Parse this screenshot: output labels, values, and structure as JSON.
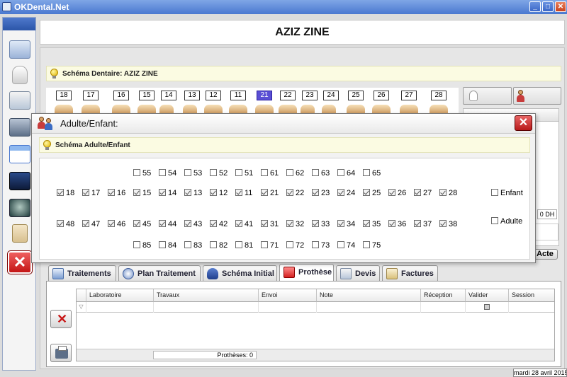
{
  "window": {
    "title": "OKDental.Net",
    "minimize": "_",
    "maximize": "□",
    "close": "✕"
  },
  "colors": {
    "titlebar": "#4a78d0",
    "selected_tooth": "#5a4fd4",
    "info_bar": "#fbfbe2"
  },
  "sidebar": {
    "items": [
      {
        "name": "patient-card-icon"
      },
      {
        "name": "tooth-icon"
      },
      {
        "name": "documents-icon"
      },
      {
        "name": "cash-register-icon"
      },
      {
        "name": "calendar-window-icon"
      },
      {
        "name": "camera-icon"
      },
      {
        "name": "xray-icon"
      },
      {
        "name": "notes-icon"
      }
    ],
    "exit_label": "✕"
  },
  "patient": {
    "name": "AZIZ ZINE"
  },
  "schema": {
    "title": "Schéma Dentaire: AZIZ ZINE",
    "upper_teeth": [
      "18",
      "17",
      "16",
      "15",
      "14",
      "13",
      "12",
      "11",
      "21",
      "22",
      "23",
      "24",
      "25",
      "26",
      "27",
      "28"
    ],
    "selected_tooth": "21"
  },
  "right_panel": {
    "amount": "0 DH",
    "acte_button": "Acte"
  },
  "dialog": {
    "title": "Adulte/Enfant:",
    "close_label": "✕",
    "info": "Schéma Adulte/Enfant",
    "child_upper": [
      "55",
      "54",
      "53",
      "52",
      "51",
      "61",
      "62",
      "63",
      "64",
      "65"
    ],
    "adult_upper": [
      "18",
      "17",
      "16",
      "15",
      "14",
      "13",
      "12",
      "11",
      "21",
      "22",
      "23",
      "24",
      "25",
      "26",
      "27",
      "28"
    ],
    "adult_lower": [
      "48",
      "47",
      "46",
      "45",
      "44",
      "43",
      "42",
      "41",
      "31",
      "32",
      "33",
      "34",
      "35",
      "36",
      "37",
      "38"
    ],
    "child_lower": [
      "85",
      "84",
      "83",
      "82",
      "81",
      "71",
      "72",
      "73",
      "74",
      "75"
    ],
    "options": {
      "enfant": "Enfant",
      "adulte": "Adulte"
    }
  },
  "tabs": [
    {
      "label": "Traitements"
    },
    {
      "label": "Plan Traitement"
    },
    {
      "label": "Schéma Initial"
    },
    {
      "label": "Prothèse"
    },
    {
      "label": "Devis"
    },
    {
      "label": "Factures"
    }
  ],
  "active_tab": "Prothèse",
  "prothese_table": {
    "columns": [
      "Laboratoire",
      "Travaux",
      "Envoi",
      "Note",
      "Réception",
      "Valider",
      "Session"
    ],
    "footer": "Prothèses: 0"
  },
  "status": {
    "date": "mardi 28 avril 2015"
  }
}
